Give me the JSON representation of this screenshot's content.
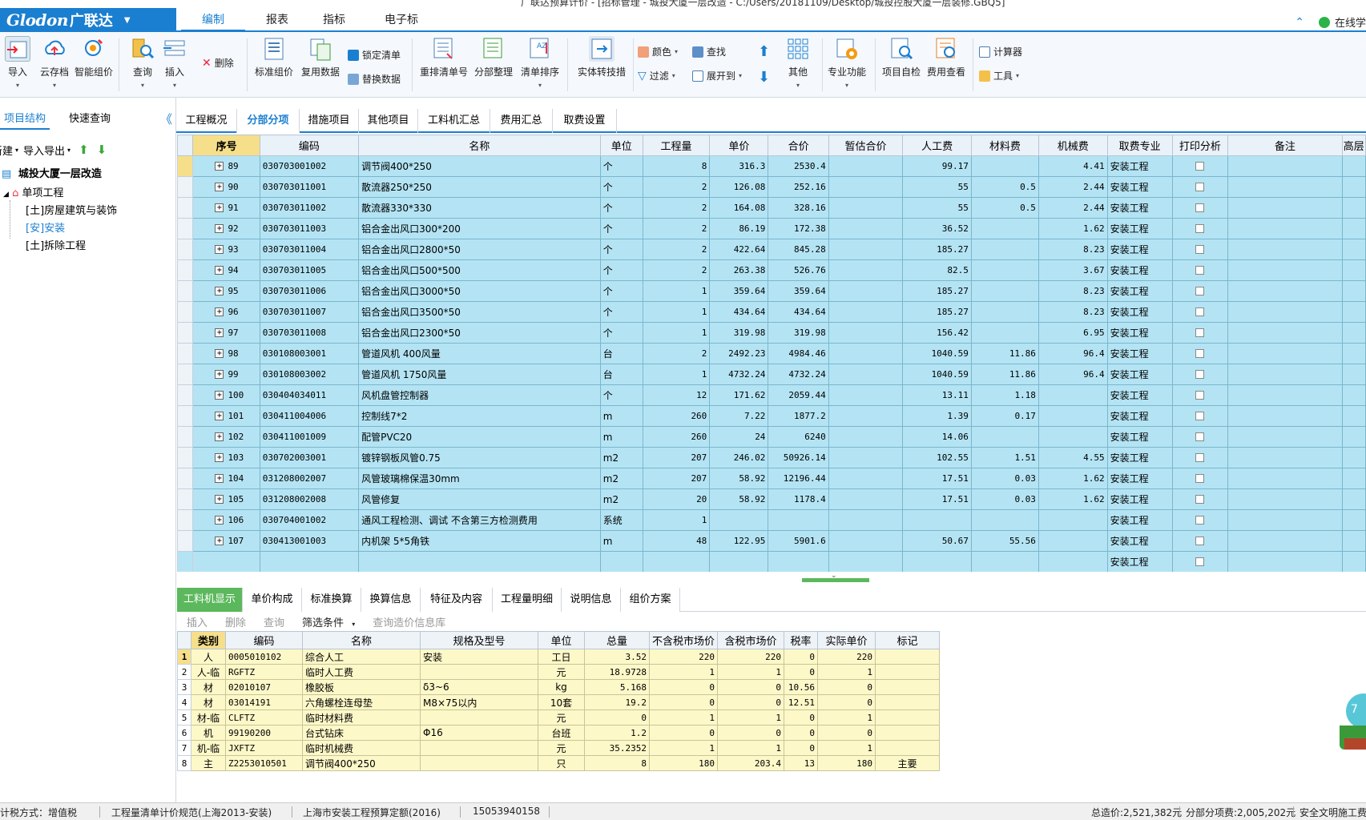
{
  "title_bar": "广联达预算计价 - [招标管理 - 城投大厦一层改造 - C:/Users/20181109/Desktop/城投控股大厦一层装修.GBQ5]",
  "logo": {
    "text_en": "Glodon",
    "text_cn": "广联达"
  },
  "menu_tabs": [
    "编制",
    "报表",
    "指标",
    "电子标"
  ],
  "online_label": "在线学",
  "ribbon": {
    "import": "导入",
    "cloud": "云存档",
    "smart_price": "智能组价",
    "query": "查询",
    "insert": "插入",
    "delete": "删除",
    "std_price": "标准组价",
    "reuse": "复用数据",
    "lock_list": "锁定清单",
    "replace_data": "替换数据",
    "renumber": "重排清单号",
    "section_tidy": "分部整理",
    "list_sort": "清单排序",
    "entity_convert": "实体转技措",
    "color": "颜色",
    "find": "查找",
    "filter": "过滤",
    "expand_to": "展开到",
    "other": "其他",
    "specialty": "专业功能",
    "self_check": "项目自检",
    "fee_view": "费用查看",
    "calculator": "计算器",
    "tools": "工具"
  },
  "left_panel": {
    "tabs": [
      "项目结构",
      "快速查询"
    ],
    "toolbar_new": "新建",
    "toolbar_import": "导入导出",
    "tree": {
      "root": "城投大厦一层改造",
      "single": "单项工程",
      "children": [
        "[土]房屋建筑与装饰",
        "[安]安装",
        "[土]拆除工程"
      ]
    }
  },
  "main_tabs": [
    "工程概况",
    "分部分项",
    "措施项目",
    "其他项目",
    "工料机汇总",
    "费用汇总",
    "取费设置"
  ],
  "grid": {
    "headers": [
      "序号",
      "编码",
      "名称",
      "单位",
      "工程量",
      "单价",
      "合价",
      "暂估合价",
      "人工费",
      "材料费",
      "机械费",
      "取费专业",
      "打印分析",
      "备注",
      "高层"
    ],
    "rows": [
      {
        "seq": "89",
        "code": "030703001002",
        "name": "调节阀400*250",
        "unit": "个",
        "qty": "8",
        "price": "316.3",
        "total": "2530.4",
        "est": "",
        "labor": "99.17",
        "material": "",
        "machine": "4.41",
        "spec": "安装工程"
      },
      {
        "seq": "90",
        "code": "030703011001",
        "name": "散流器250*250",
        "unit": "个",
        "qty": "2",
        "price": "126.08",
        "total": "252.16",
        "est": "",
        "labor": "55",
        "material": "0.5",
        "machine": "2.44",
        "spec": "安装工程"
      },
      {
        "seq": "91",
        "code": "030703011002",
        "name": "散流器330*330",
        "unit": "个",
        "qty": "2",
        "price": "164.08",
        "total": "328.16",
        "est": "",
        "labor": "55",
        "material": "0.5",
        "machine": "2.44",
        "spec": "安装工程"
      },
      {
        "seq": "92",
        "code": "030703011003",
        "name": "铝合金出风口300*200",
        "unit": "个",
        "qty": "2",
        "price": "86.19",
        "total": "172.38",
        "est": "",
        "labor": "36.52",
        "material": "",
        "machine": "1.62",
        "spec": "安装工程"
      },
      {
        "seq": "93",
        "code": "030703011004",
        "name": "铝合金出风口2800*50",
        "unit": "个",
        "qty": "2",
        "price": "422.64",
        "total": "845.28",
        "est": "",
        "labor": "185.27",
        "material": "",
        "machine": "8.23",
        "spec": "安装工程"
      },
      {
        "seq": "94",
        "code": "030703011005",
        "name": "铝合金出风口500*500",
        "unit": "个",
        "qty": "2",
        "price": "263.38",
        "total": "526.76",
        "est": "",
        "labor": "82.5",
        "material": "",
        "machine": "3.67",
        "spec": "安装工程"
      },
      {
        "seq": "95",
        "code": "030703011006",
        "name": "铝合金出风口3000*50",
        "unit": "个",
        "qty": "1",
        "price": "359.64",
        "total": "359.64",
        "est": "",
        "labor": "185.27",
        "material": "",
        "machine": "8.23",
        "spec": "安装工程"
      },
      {
        "seq": "96",
        "code": "030703011007",
        "name": "铝合金出风口3500*50",
        "unit": "个",
        "qty": "1",
        "price": "434.64",
        "total": "434.64",
        "est": "",
        "labor": "185.27",
        "material": "",
        "machine": "8.23",
        "spec": "安装工程"
      },
      {
        "seq": "97",
        "code": "030703011008",
        "name": "铝合金出风口2300*50",
        "unit": "个",
        "qty": "1",
        "price": "319.98",
        "total": "319.98",
        "est": "",
        "labor": "156.42",
        "material": "",
        "machine": "6.95",
        "spec": "安装工程"
      },
      {
        "seq": "98",
        "code": "030108003001",
        "name": "管道风机 400风量",
        "unit": "台",
        "qty": "2",
        "price": "2492.23",
        "total": "4984.46",
        "est": "",
        "labor": "1040.59",
        "material": "11.86",
        "machine": "96.4",
        "spec": "安装工程"
      },
      {
        "seq": "99",
        "code": "030108003002",
        "name": "管道风机 1750风量",
        "unit": "台",
        "qty": "1",
        "price": "4732.24",
        "total": "4732.24",
        "est": "",
        "labor": "1040.59",
        "material": "11.86",
        "machine": "96.4",
        "spec": "安装工程"
      },
      {
        "seq": "100",
        "code": "030404034011",
        "name": "风机盘管控制器",
        "unit": "个",
        "qty": "12",
        "price": "171.62",
        "total": "2059.44",
        "est": "",
        "labor": "13.11",
        "material": "1.18",
        "machine": "",
        "spec": "安装工程"
      },
      {
        "seq": "101",
        "code": "030411004006",
        "name": "控制线7*2",
        "unit": "m",
        "qty": "260",
        "price": "7.22",
        "total": "1877.2",
        "est": "",
        "labor": "1.39",
        "material": "0.17",
        "machine": "",
        "spec": "安装工程"
      },
      {
        "seq": "102",
        "code": "030411001009",
        "name": "配管PVC20",
        "unit": "m",
        "qty": "260",
        "price": "24",
        "total": "6240",
        "est": "",
        "labor": "14.06",
        "material": "",
        "machine": "",
        "spec": "安装工程"
      },
      {
        "seq": "103",
        "code": "030702003001",
        "name": "镀锌钢板风管0.75",
        "unit": "m2",
        "qty": "207",
        "price": "246.02",
        "total": "50926.14",
        "est": "",
        "labor": "102.55",
        "material": "1.51",
        "machine": "4.55",
        "spec": "安装工程"
      },
      {
        "seq": "104",
        "code": "031208002007",
        "name": "风管玻璃棉保温30mm",
        "unit": "m2",
        "qty": "207",
        "price": "58.92",
        "total": "12196.44",
        "est": "",
        "labor": "17.51",
        "material": "0.03",
        "machine": "1.62",
        "spec": "安装工程"
      },
      {
        "seq": "105",
        "code": "031208002008",
        "name": "风管修复",
        "unit": "m2",
        "qty": "20",
        "price": "58.92",
        "total": "1178.4",
        "est": "",
        "labor": "17.51",
        "material": "0.03",
        "machine": "1.62",
        "spec": "安装工程"
      },
      {
        "seq": "106",
        "code": "030704001002",
        "name": "通风工程检测、调试 不含第三方检测费用",
        "unit": "系统",
        "qty": "1",
        "price": "",
        "total": "",
        "est": "",
        "labor": "",
        "material": "",
        "machine": "",
        "spec": "安装工程"
      },
      {
        "seq": "107",
        "code": "030413001003",
        "name": "内机架 5*5角铁",
        "unit": "m",
        "qty": "48",
        "price": "122.95",
        "total": "5901.6",
        "est": "",
        "labor": "50.67",
        "material": "55.56",
        "machine": "",
        "spec": "安装工程"
      }
    ],
    "empty_row_spec": "安装工程"
  },
  "bottom_tabs": [
    "工料机显示",
    "单价构成",
    "标准换算",
    "换算信息",
    "特征及内容",
    "工程量明细",
    "说明信息",
    "组价方案"
  ],
  "bottom_toolbar": [
    "插入",
    "删除",
    "查询",
    "筛选条件",
    "查询造价信息库"
  ],
  "bottom_grid": {
    "headers": [
      "类别",
      "编码",
      "名称",
      "规格及型号",
      "单位",
      "总量",
      "不含税市场价",
      "含税市场价",
      "税率",
      "实际单价",
      "标记"
    ],
    "rows": [
      {
        "idx": "1",
        "cat": "人",
        "code": "0005010102",
        "name": "综合人工",
        "spec": "安装",
        "unit": "工日",
        "qty": "3.52",
        "p1": "220",
        "p2": "220",
        "tax": "0",
        "actual": "220",
        "mark": ""
      },
      {
        "idx": "2",
        "cat": "人-临",
        "code": "RGFTZ",
        "name": "临时人工费",
        "spec": "",
        "unit": "元",
        "qty": "18.9728",
        "p1": "1",
        "p2": "1",
        "tax": "0",
        "actual": "1",
        "mark": ""
      },
      {
        "idx": "3",
        "cat": "材",
        "code": "02010107",
        "name": "橡胶板",
        "spec": "δ3~6",
        "unit": "kg",
        "qty": "5.168",
        "p1": "0",
        "p2": "0",
        "tax": "10.56",
        "actual": "0",
        "mark": ""
      },
      {
        "idx": "4",
        "cat": "材",
        "code": "03014191",
        "name": "六角螺栓连母垫",
        "spec": "M8×75以内",
        "unit": "10套",
        "qty": "19.2",
        "p1": "0",
        "p2": "0",
        "tax": "12.51",
        "actual": "0",
        "mark": ""
      },
      {
        "idx": "5",
        "cat": "材-临",
        "code": "CLFTZ",
        "name": "临时材料费",
        "spec": "",
        "unit": "元",
        "qty": "0",
        "p1": "1",
        "p2": "1",
        "tax": "0",
        "actual": "1",
        "mark": ""
      },
      {
        "idx": "6",
        "cat": "机",
        "code": "99190200",
        "name": "台式钻床",
        "spec": "Φ16",
        "unit": "台班",
        "qty": "1.2",
        "p1": "0",
        "p2": "0",
        "tax": "0",
        "actual": "0",
        "mark": ""
      },
      {
        "idx": "7",
        "cat": "机-临",
        "code": "JXFTZ",
        "name": "临时机械费",
        "spec": "",
        "unit": "元",
        "qty": "35.2352",
        "p1": "1",
        "p2": "1",
        "tax": "0",
        "actual": "1",
        "mark": ""
      },
      {
        "idx": "8",
        "cat": "主",
        "code": "Z2253010501",
        "name": "调节阀400*250",
        "spec": "",
        "unit": "只",
        "qty": "8",
        "p1": "180",
        "p2": "203.4",
        "tax": "13",
        "actual": "180",
        "mark": "主要"
      }
    ]
  },
  "widget_number": "7",
  "status": {
    "tax_mode": "计税方式：增值税",
    "spec_list": "工程量清单计价规范(上海2013-安装)",
    "quota": "上海市安装工程预算定额(2016)",
    "id": "15053940158",
    "total": "总造价:2,521,382元",
    "section_total": "分部分项费:2,005,202元",
    "safety": "安全文明施工费"
  },
  "colors": {
    "accent": "#1a7fd0",
    "row_bg": "#b4e4f4",
    "bottom_row_bg": "#fdf8c8",
    "active_bottom_tab": "#5cb85c",
    "header_highlight": "#f6df8a"
  }
}
